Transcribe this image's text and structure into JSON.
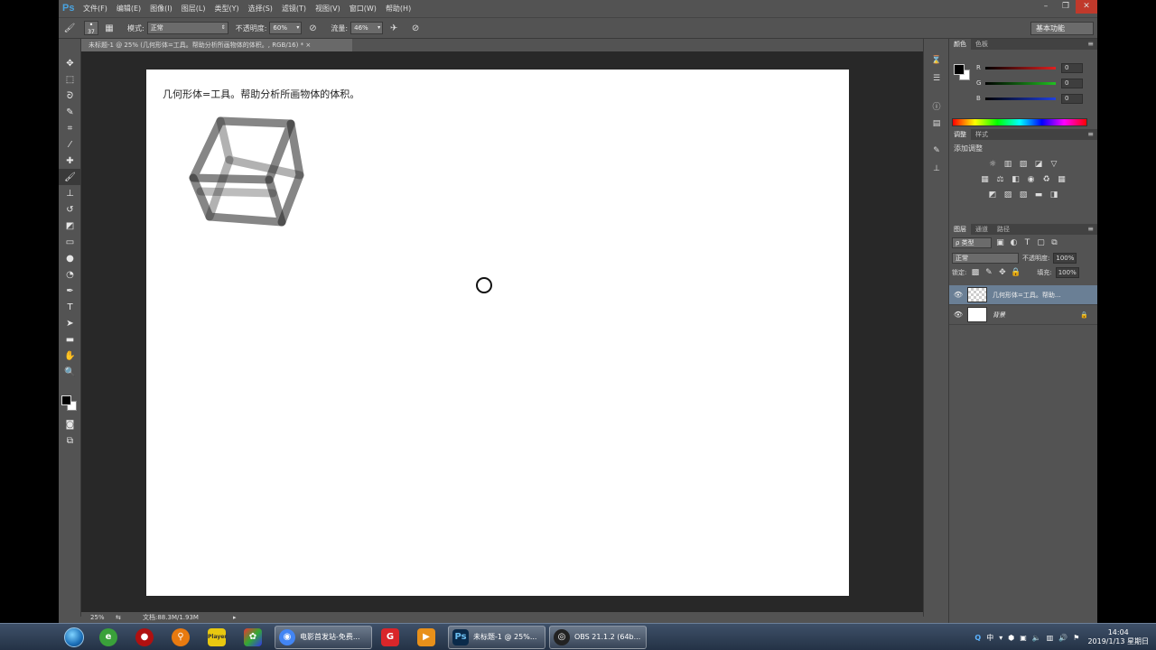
{
  "menubar": {
    "logo": "Ps",
    "items": [
      "文件(F)",
      "编辑(E)",
      "图像(I)",
      "图层(L)",
      "类型(Y)",
      "选择(S)",
      "滤镜(T)",
      "视图(V)",
      "窗口(W)",
      "帮助(H)"
    ],
    "window_controls": [
      "–",
      "❐",
      "✕"
    ]
  },
  "options": {
    "brush_size": "37",
    "mode_label": "模式:",
    "mode_value": "正常",
    "opacity_label": "不透明度:",
    "opacity_value": "60%",
    "flow_label": "流量:",
    "flow_value": "46%",
    "workspace": "基本功能"
  },
  "document": {
    "tab_title": "未标题-1 @ 25% (几何形体=工具。帮助分析所画物体的体积。, RGB/16) *",
    "canvas_text": "几何形体=工具。帮助分析所画物体的体积。",
    "zoom": "25%",
    "doc_info": "文档:88.3M/1.93M"
  },
  "color_panel": {
    "tabs": [
      "颜色",
      "色板"
    ],
    "channels": [
      {
        "label": "R",
        "value": "0",
        "color": "#e02020"
      },
      {
        "label": "G",
        "value": "0",
        "color": "#20c020"
      },
      {
        "label": "B",
        "value": "0",
        "color": "#2040e0"
      }
    ]
  },
  "adjust_panel": {
    "tabs": [
      "调整",
      "样式"
    ],
    "title": "添加调整"
  },
  "layers_panel": {
    "tabs": [
      "图层",
      "通道",
      "路径"
    ],
    "filter_kind": "ρ 类型",
    "blend_mode": "正常",
    "opacity_label": "不透明度:",
    "opacity_value": "100%",
    "lock_label": "锁定:",
    "fill_label": "填充:",
    "fill_value": "100%",
    "layers": [
      {
        "name": "几何形体=工具。帮助...",
        "selected": true
      },
      {
        "name": "背景",
        "selected": false
      }
    ]
  },
  "taskbar": {
    "tasks": [
      {
        "label": "电影首发站-免费...",
        "color": "#4285f4",
        "glyph": "◉"
      },
      {
        "label": "未标题-1 @ 25%...",
        "color": "#0a2a4a",
        "glyph": "Ps"
      },
      {
        "label": "OBS 21.1.2 (64b...",
        "color": "#222",
        "glyph": "◎"
      }
    ],
    "time": "14:04",
    "date": "2019/1/13 星期日",
    "ime": "中"
  }
}
